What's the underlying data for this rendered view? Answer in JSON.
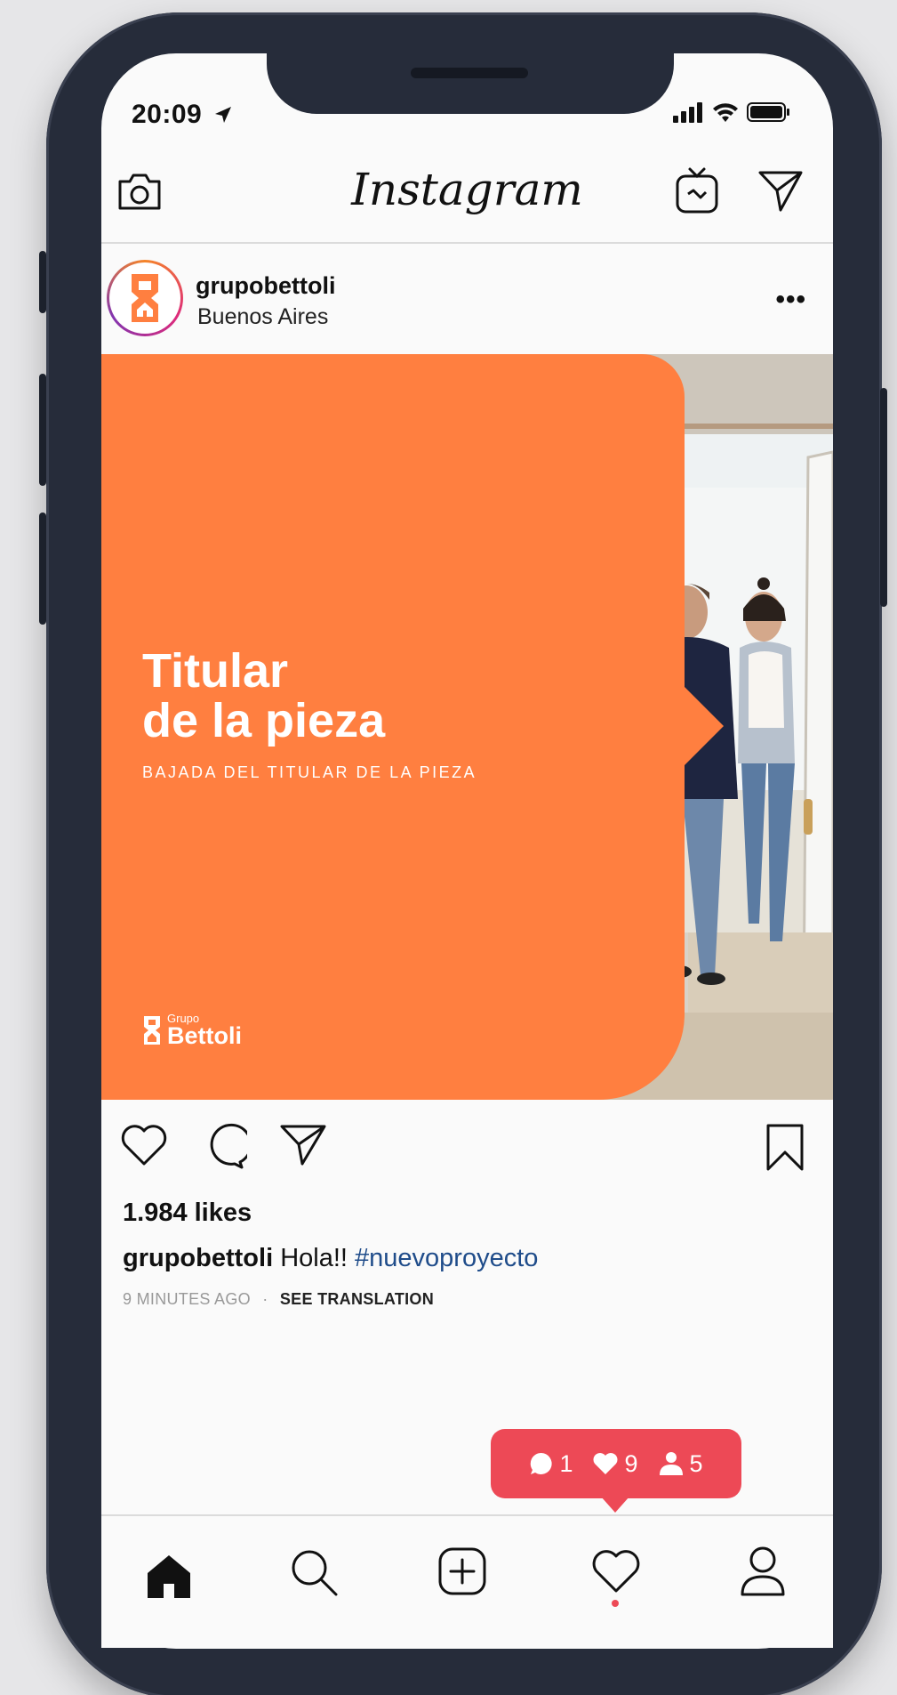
{
  "status_bar": {
    "time": "20:09"
  },
  "header": {
    "app_title": "Instagram"
  },
  "post": {
    "username": "grupobettoli",
    "location": "Buenos Aires",
    "more_label": "•••",
    "image": {
      "headline_line1": "Titular",
      "headline_line2": "de la pieza",
      "subheadline": "BAJADA DEL TITULAR DE LA PIEZA",
      "brand_small": "Grupo",
      "brand_big": "Bettoli"
    },
    "likes": "1.984 likes",
    "caption_user": "grupobettoli",
    "caption_text": "Hola!!",
    "caption_tag": "#nuevoproyecto",
    "time_ago": "9 MINUTES AGO",
    "separator": "·",
    "see_translation": "SEE TRANSLATION"
  },
  "activity": {
    "comments": "1",
    "likes": "9",
    "follows": "5"
  },
  "colors": {
    "brand_orange": "#ff7f40",
    "notification_red": "#ed4956",
    "hashtag_blue": "#1f4c8a",
    "phone_frame": "#262c3a"
  }
}
